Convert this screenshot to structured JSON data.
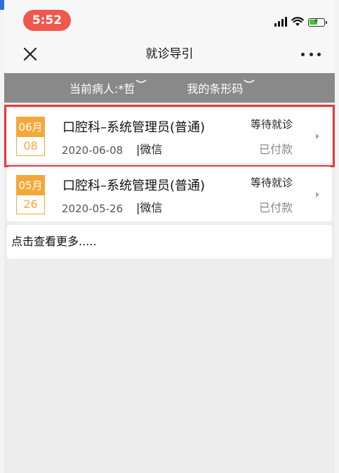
{
  "status_bar": {
    "time": "5:52"
  },
  "nav": {
    "title": "就诊导引",
    "close_icon": "close-icon",
    "more_icon": "more-dots-icon"
  },
  "filter": {
    "patient_label": "当前病人:*哲",
    "barcode_label": "我的条形码"
  },
  "appointments": [
    {
      "month": "06月",
      "day": "08",
      "title": "口腔科–系统管理员(普通)",
      "date": "2020-06-08",
      "payment": "|微信",
      "status": "等待就诊",
      "paid": "已付款"
    },
    {
      "month": "05月",
      "day": "26",
      "title": "口腔科–系统管理员(普通)",
      "date": "2020-05-26",
      "payment": "|微信",
      "status": "等待就诊",
      "paid": "已付款"
    }
  ],
  "more": {
    "label": "点击查看更多....."
  },
  "colors": {
    "time_pill": "#f0584c",
    "filter_bar": "#898989",
    "date_accent": "#f3a93a",
    "highlight_border": "#e23a3f",
    "battery_fill": "#3fc43b"
  }
}
